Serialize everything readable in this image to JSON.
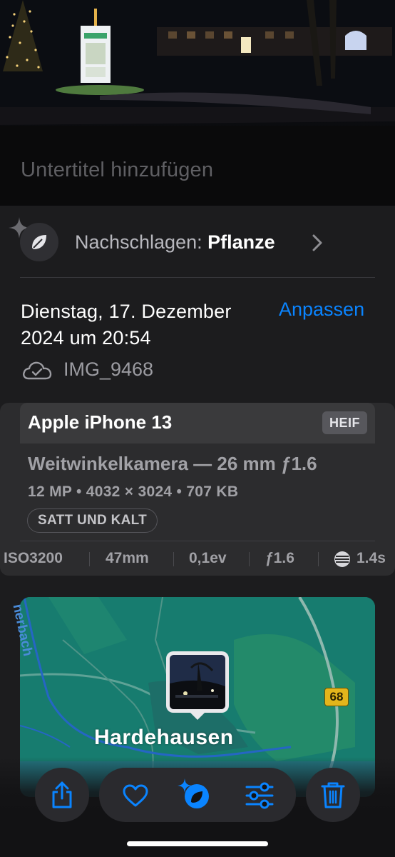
{
  "caption": {
    "placeholder": "Untertitel hinzufügen"
  },
  "lookup": {
    "prefix": "Nachschlagen:",
    "subject": "Pflanze",
    "icon": "leaf-icon"
  },
  "date": {
    "line1": "Dienstag, 17. Dezember",
    "line2": "2024 um 20:54",
    "adjust_label": "Anpassen"
  },
  "file": {
    "name": "IMG_9468",
    "icon": "icloud-check-icon"
  },
  "camera": {
    "device": "Apple iPhone 13",
    "format": "HEIF",
    "lens": "Weitwinkelkamera — 26 mm ƒ1.6",
    "specs": "12 MP • 4032 × 3024 • 707 KB",
    "style": "SATT UND KALT"
  },
  "exif": {
    "iso": "ISO3200",
    "focal": "47mm",
    "ev": "0,1ev",
    "aperture": "ƒ1.6",
    "shutter": "1.4s"
  },
  "map": {
    "place": "Hardehausen",
    "stream": "nerbach",
    "road": "68"
  },
  "toolbar": {
    "share": "share-icon",
    "favorite": "heart-icon",
    "visual_lookup": "visual-lookup-icon",
    "edit": "sliders-icon",
    "delete": "trash-icon"
  },
  "colors": {
    "accent": "#0a84ff",
    "background": "#1c1c1e",
    "card": "#2c2c2e",
    "map_water": "#157a6e"
  }
}
